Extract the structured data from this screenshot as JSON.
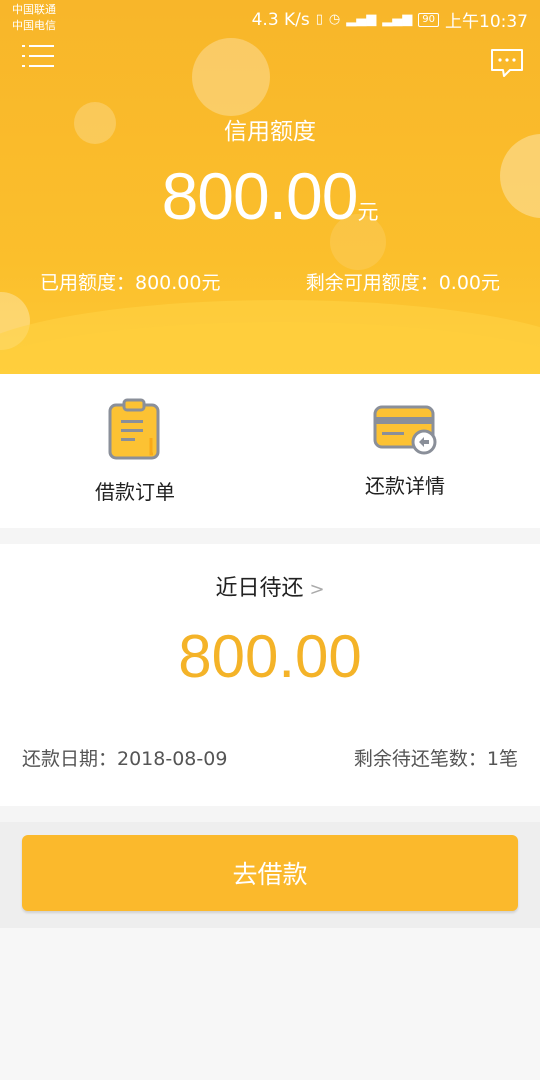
{
  "status_bar": {
    "carrier_1": "中国联通",
    "carrier_2": "中国电信",
    "net_speed": "4.3 K/s",
    "battery": "90",
    "time": "上午10:37"
  },
  "header": {
    "menu_icon": "menu-icon",
    "message_icon": "message-icon",
    "credit_title": "信用额度",
    "credit_amount": "800.00",
    "credit_unit": "元",
    "used_label": "已用额度：800.00元",
    "remaining_label": "剩余可用额度：0.00元"
  },
  "actions": [
    {
      "label": "借款订单",
      "icon": "clipboard-icon"
    },
    {
      "label": "还款详情",
      "icon": "card-refund-icon"
    }
  ],
  "pending": {
    "title": "近日待还",
    "chevron": ">",
    "amount": "800.00",
    "due_date": "还款日期：2018-08-09",
    "remaining_count": "剩余待还笔数：1笔"
  },
  "borrow_button": "去借款",
  "colors": {
    "accent": "#fbb92c",
    "amount_text": "#f4b328"
  }
}
